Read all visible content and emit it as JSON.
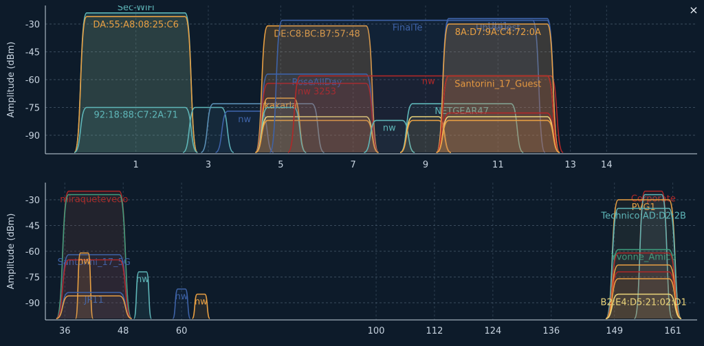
{
  "window": {
    "close_icon": "close-icon",
    "close_glyph": "×"
  },
  "colors": {
    "background": "#0d1b2a",
    "axis_text": "#c8d4e0",
    "grid": "#4d6275",
    "teal": "#5fb7b9",
    "orange": "#e9a043",
    "red": "#b02828",
    "blue": "#3e63a8",
    "yellow": "#ecd57a",
    "green": "#3f9f7f",
    "steel": "#5a8fb5"
  },
  "chart_data": [
    {
      "id": "band-2g",
      "type": "area",
      "ylabel": "Amplitude (dBm)",
      "xlim": [
        -1.5,
        16.5
      ],
      "ylim": [
        -100,
        -20
      ],
      "x_ticks": [
        1,
        3,
        5,
        7,
        9,
        11,
        13,
        14
      ],
      "y_ticks": [
        -30,
        -45,
        -60,
        -75,
        -90
      ],
      "grid": true,
      "networks": [
        {
          "label": "Sec-WiFi",
          "center": 1,
          "width": 3.4,
          "amp": -24,
          "color": "#5fb7b9",
          "label_pos": "top",
          "opacity": 0.18
        },
        {
          "label": "DA:55:A8:08:25:C6",
          "center": 1,
          "width": 3.4,
          "amp": -26,
          "color": "#e9a043",
          "label_pos": "below",
          "opacity": 0.08
        },
        {
          "label": "92:18:88:C7:2A:71",
          "center": 1,
          "width": 3.4,
          "amp": -75,
          "color": "#5fb7b9",
          "label_pos": "inside",
          "opacity": 0.08
        },
        {
          "label": "",
          "center": 3,
          "width": 1.4,
          "amp": -75,
          "color": "#5fb7b9",
          "label_pos": "none",
          "opacity": 0.06
        },
        {
          "label": "",
          "center": 4.5,
          "width": 3.4,
          "amp": -73,
          "color": "#5a8fb5",
          "label_pos": "none",
          "opacity": 0.06
        },
        {
          "label": "nw",
          "center": 4,
          "width": 1.6,
          "amp": -77,
          "color": "#3e63a8",
          "label_pos": "below",
          "opacity": 0.05
        },
        {
          "label": "DE:C8:BC:B7:57:48",
          "center": 6,
          "width": 3.4,
          "amp": -31,
          "color": "#e9a043",
          "label_pos": "below",
          "opacity": 0.2
        },
        {
          "label": "RoseAllDay",
          "center": 6,
          "width": 3.4,
          "amp": -57,
          "color": "#3e63a8",
          "label_pos": "below",
          "opacity": 0.08
        },
        {
          "label": "nw 3253",
          "center": 6,
          "width": 3.4,
          "amp": -62,
          "color": "#b02828",
          "label_pos": "below",
          "opacity": 0.1
        },
        {
          "label": "kakarla",
          "center": 5,
          "width": 1.4,
          "amp": -70,
          "color": "#e9a043",
          "label_pos": "inside",
          "opacity": 0.05
        },
        {
          "label": "",
          "center": 5,
          "width": 1.4,
          "amp": -75,
          "color": "#5fb7b9",
          "label_pos": "none",
          "opacity": 0.04
        },
        {
          "label": "",
          "center": 6,
          "width": 3.4,
          "amp": -80,
          "color": "#ecd57a",
          "label_pos": "none",
          "opacity": 0.06
        },
        {
          "label": "",
          "center": 6,
          "width": 3.4,
          "amp": -82,
          "color": "#e9a043",
          "label_pos": "none",
          "opacity": 0.05
        },
        {
          "label": "FinalTe",
          "center": 8.5,
          "width": 7.6,
          "amp": -28,
          "color": "#3e63a8",
          "label_pos": "inside",
          "opacity": 0.1
        },
        {
          "label": "",
          "center": 9,
          "width": 7.6,
          "amp": -58,
          "color": "#b02828",
          "label_pos": "none",
          "opacity": 0.06
        },
        {
          "label": "nw",
          "center": 8,
          "width": 1.4,
          "amp": -82,
          "color": "#5fb7b9",
          "label_pos": "inside",
          "opacity": 0.05
        },
        {
          "label": "NETGEAR47",
          "center": 10,
          "width": 3.4,
          "amp": -73,
          "color": "#5fb7b9",
          "label_pos": "inside",
          "opacity": 0.06
        },
        {
          "label": "",
          "center": 9,
          "width": 1.4,
          "amp": -80,
          "color": "#ecd57a",
          "label_pos": "none",
          "opacity": 0.05
        },
        {
          "label": "",
          "center": 9,
          "width": 1.4,
          "amp": -82,
          "color": "#e9a043",
          "label_pos": "none",
          "opacity": 0.05
        },
        {
          "label": "Ubi1",
          "center": 11,
          "width": 3.4,
          "amp": -27,
          "color": "#3e63a8",
          "label_pos": "inside",
          "opacity": 0.06
        },
        {
          "label": "Ubi-Guest",
          "center": 11,
          "width": 3.4,
          "amp": -28,
          "color": "#3e63a8",
          "label_pos": "inside",
          "opacity": 0.06
        },
        {
          "label": "8A:D7:9A:C4:72:0A",
          "center": 11,
          "width": 3.4,
          "amp": -30,
          "color": "#e9a043",
          "label_pos": "below",
          "opacity": 0.18
        },
        {
          "label": "Santorini_17_Guest",
          "center": 11,
          "width": 3.4,
          "amp": -58,
          "color": "#e9a043",
          "label_pos": "below",
          "opacity": 0.1
        },
        {
          "label": "nw",
          "center": 11,
          "width": 3.4,
          "amp": -58,
          "color": "#b02828",
          "label_pos": "left",
          "opacity": 0.06
        },
        {
          "label": "",
          "center": 11,
          "width": 3.4,
          "amp": -78,
          "color": "#b02828",
          "label_pos": "none",
          "opacity": 0.05
        },
        {
          "label": "",
          "center": 11,
          "width": 3.4,
          "amp": -80,
          "color": "#ecd57a",
          "label_pos": "none",
          "opacity": 0.06
        },
        {
          "label": "",
          "center": 11,
          "width": 3.4,
          "amp": -82,
          "color": "#e9a043",
          "label_pos": "none",
          "opacity": 0.05
        }
      ]
    },
    {
      "id": "band-5g",
      "type": "area",
      "ylabel": "Amplitude (dBm)",
      "xlim": [
        32,
        166
      ],
      "ylim": [
        -100,
        -20
      ],
      "x_ticks": [
        36,
        48,
        60,
        100,
        112,
        124,
        136,
        149,
        161
      ],
      "y_ticks": [
        -30,
        -45,
        -60,
        -75,
        -90
      ],
      "grid": true,
      "networks": [
        {
          "label": "miraquetevedo",
          "center": 42,
          "width": 15.5,
          "amp": -25,
          "color": "#b02828",
          "label_pos": "below",
          "opacity": 0.12
        },
        {
          "label": "",
          "center": 42,
          "width": 15.5,
          "amp": -27,
          "color": "#3f9f7f",
          "label_pos": "none",
          "opacity": 0.06
        },
        {
          "label": "Santorini_17_5G",
          "center": 42,
          "width": 15.5,
          "amp": -62,
          "color": "#3e63a8",
          "label_pos": "inside",
          "opacity": 0.06
        },
        {
          "label": "",
          "center": 42,
          "width": 15.5,
          "amp": -65,
          "color": "#b02828",
          "label_pos": "none",
          "opacity": 0.05
        },
        {
          "label": "nw",
          "center": 40,
          "width": 3.6,
          "amp": -61,
          "color": "#e9a043",
          "label_pos": "below",
          "opacity": 0.12
        },
        {
          "label": "JP11",
          "center": 42,
          "width": 15.5,
          "amp": -84,
          "color": "#3e63a8",
          "label_pos": "inside",
          "opacity": 0.05
        },
        {
          "label": "",
          "center": 42,
          "width": 15.5,
          "amp": -86,
          "color": "#e9a043",
          "label_pos": "none",
          "opacity": 0.05
        },
        {
          "label": "nw",
          "center": 52,
          "width": 3.6,
          "amp": -72,
          "color": "#5fb7b9",
          "label_pos": "inside",
          "opacity": 0.1
        },
        {
          "label": "nw",
          "center": 60,
          "width": 3.6,
          "amp": -82,
          "color": "#3e63a8",
          "label_pos": "inside",
          "opacity": 0.08
        },
        {
          "label": "nw",
          "center": 64,
          "width": 3.6,
          "amp": -85,
          "color": "#e9a043",
          "label_pos": "inside",
          "opacity": 0.1
        },
        {
          "label": "Corporate",
          "center": 157,
          "width": 7.8,
          "amp": -25,
          "color": "#b02828",
          "label_pos": "inside",
          "opacity": 0.06
        },
        {
          "label": "",
          "center": 157,
          "width": 7.8,
          "amp": -27,
          "color": "#5fb7b9",
          "label_pos": "none",
          "opacity": 0.1
        },
        {
          "label": "PVG1",
          "center": 155,
          "width": 15.5,
          "amp": -30,
          "color": "#e9a043",
          "label_pos": "inside",
          "opacity": 0.05
        },
        {
          "label": "Technico:AD:D2:2B",
          "center": 155,
          "width": 15.5,
          "amp": -35,
          "color": "#5fb7b9",
          "label_pos": "inside",
          "opacity": 0.05
        },
        {
          "label": "Yvonne_Amico",
          "center": 155,
          "width": 15.5,
          "amp": -59,
          "color": "#3f9f7f",
          "label_pos": "inside",
          "opacity": 0.06
        },
        {
          "label": "",
          "center": 155,
          "width": 15.5,
          "amp": -61,
          "color": "#b02828",
          "label_pos": "none",
          "opacity": 0.06
        },
        {
          "label": "",
          "center": 155,
          "width": 15.5,
          "amp": -68,
          "color": "#e9a043",
          "label_pos": "none",
          "opacity": 0.06
        },
        {
          "label": "",
          "center": 155,
          "width": 15.5,
          "amp": -72,
          "color": "#b02828",
          "label_pos": "none",
          "opacity": 0.05
        },
        {
          "label": "",
          "center": 155,
          "width": 15.5,
          "amp": -76,
          "color": "#e9a043",
          "label_pos": "none",
          "opacity": 0.05
        },
        {
          "label": "B2:E4:D5:21:02:D1",
          "center": 155,
          "width": 15.5,
          "amp": -85,
          "color": "#ecd57a",
          "label_pos": "below",
          "opacity": 0.06
        }
      ]
    }
  ]
}
